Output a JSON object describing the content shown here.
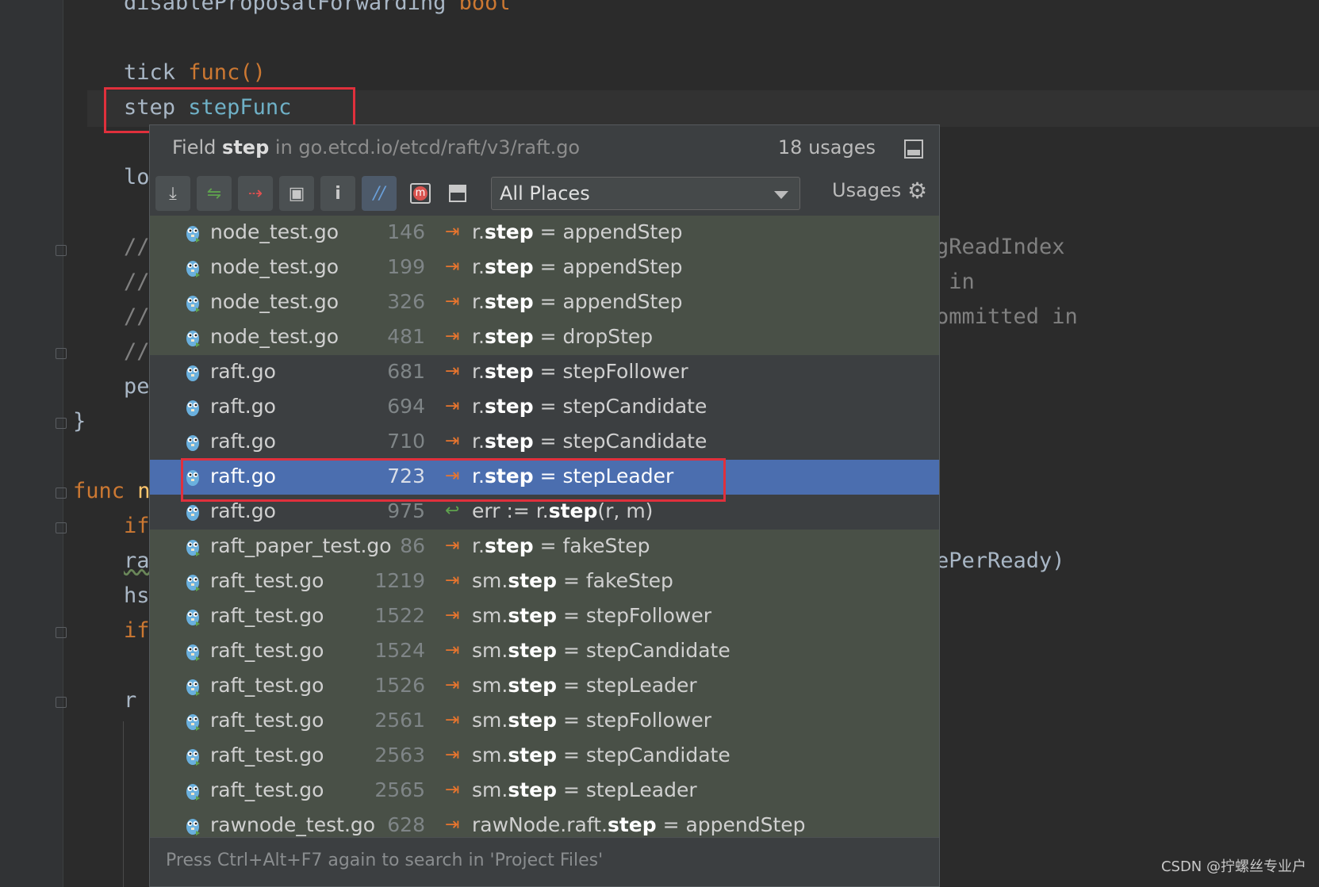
{
  "editor": {
    "lines": {
      "l1_field": "disableProposalForwarding",
      "l1_type": "bool",
      "l2_field": "tick",
      "l2_type": "func()",
      "l3_field": "step",
      "l3_type": "stepFunc",
      "l4": "lo",
      "c1": "//",
      "c2": "//",
      "c3": "//",
      "c4": "//",
      "pe": "pe",
      "brace": "}",
      "func_kw": "func",
      "func_rest": "n",
      "if1": "if",
      "ra": "ra",
      "hs": "hs",
      "if2": "if",
      "r": "r"
    },
    "right_fragments": {
      "f1": "gReadIndex",
      "f2": " in",
      "f3": "ommitted in",
      "f4": "ePerReady)"
    }
  },
  "popup": {
    "header": {
      "prefix": "Field",
      "name": "step",
      "location": "in go.etcd.io/etcd/raft/v3/raft.go",
      "usages_count": "18 usages",
      "pin_icon": "pin-icon"
    },
    "toolbar": {
      "buttons": [
        {
          "icon": "expand-all-icon",
          "glyph": "⤓"
        },
        {
          "icon": "read-access-icon",
          "glyph": "⇋"
        },
        {
          "icon": "write-access-icon",
          "glyph": "⇢"
        },
        {
          "icon": "group-by-directory-icon",
          "glyph": "▣"
        },
        {
          "icon": "info-icon",
          "glyph": "i"
        },
        {
          "icon": "merge-icon",
          "glyph": "//"
        },
        {
          "icon": "group-by-method-icon",
          "glyph": "m"
        },
        {
          "icon": "preview-icon",
          "glyph": "▬"
        }
      ],
      "scope": "All Places",
      "usages_label": "Usages",
      "gear_icon": "gear-icon"
    },
    "rows": [
      {
        "file": "node_test.go",
        "line": "146",
        "obj": "r.",
        "field": "step",
        "rest": " = appendStep",
        "kind": "write",
        "bg": "g"
      },
      {
        "file": "node_test.go",
        "line": "199",
        "obj": "r.",
        "field": "step",
        "rest": " = appendStep",
        "kind": "write",
        "bg": "g"
      },
      {
        "file": "node_test.go",
        "line": "326",
        "obj": "r.",
        "field": "step",
        "rest": " = appendStep",
        "kind": "write",
        "bg": "g"
      },
      {
        "file": "node_test.go",
        "line": "481",
        "obj": "r.",
        "field": "step",
        "rest": " = dropStep",
        "kind": "write",
        "bg": "g"
      },
      {
        "file": "raft.go",
        "line": "681",
        "obj": "r.",
        "field": "step",
        "rest": " = stepFollower",
        "kind": "write",
        "bg": "d"
      },
      {
        "file": "raft.go",
        "line": "694",
        "obj": "r.",
        "field": "step",
        "rest": " = stepCandidate",
        "kind": "write",
        "bg": "d"
      },
      {
        "file": "raft.go",
        "line": "710",
        "obj": "r.",
        "field": "step",
        "rest": " = stepCandidate",
        "kind": "write",
        "bg": "d"
      },
      {
        "file": "raft.go",
        "line": "723",
        "obj": "r.",
        "field": "step",
        "rest": " = stepLeader",
        "kind": "write",
        "bg": "sel"
      },
      {
        "file": "raft.go",
        "line": "975",
        "obj": "err := r.",
        "field": "step",
        "rest": "(r, m)",
        "kind": "read",
        "bg": "d"
      },
      {
        "file": "raft_paper_test.go",
        "line": "86",
        "obj": "r.",
        "field": "step",
        "rest": " = fakeStep",
        "kind": "write",
        "bg": "g"
      },
      {
        "file": "raft_test.go",
        "line": "1219",
        "obj": "sm.",
        "field": "step",
        "rest": " = fakeStep",
        "kind": "write",
        "bg": "g"
      },
      {
        "file": "raft_test.go",
        "line": "1522",
        "obj": "sm.",
        "field": "step",
        "rest": " = stepFollower",
        "kind": "write",
        "bg": "g"
      },
      {
        "file": "raft_test.go",
        "line": "1524",
        "obj": "sm.",
        "field": "step",
        "rest": " = stepCandidate",
        "kind": "write",
        "bg": "g"
      },
      {
        "file": "raft_test.go",
        "line": "1526",
        "obj": "sm.",
        "field": "step",
        "rest": " = stepLeader",
        "kind": "write",
        "bg": "g"
      },
      {
        "file": "raft_test.go",
        "line": "2561",
        "obj": "sm.",
        "field": "step",
        "rest": " = stepFollower",
        "kind": "write",
        "bg": "g"
      },
      {
        "file": "raft_test.go",
        "line": "2563",
        "obj": "sm.",
        "field": "step",
        "rest": " = stepCandidate",
        "kind": "write",
        "bg": "g"
      },
      {
        "file": "raft_test.go",
        "line": "2565",
        "obj": "sm.",
        "field": "step",
        "rest": " = stepLeader",
        "kind": "write",
        "bg": "g"
      },
      {
        "file": "rawnode_test.go",
        "line": "628",
        "obj": "rawNode.raft.",
        "field": "step",
        "rest": " = appendStep",
        "kind": "write",
        "bg": "g"
      }
    ],
    "footer": "Press Ctrl+Alt+F7 again to search in 'Project Files'"
  },
  "watermark": "CSDN @拧螺丝专业户",
  "colors": {
    "write_arrow": "#e8752e",
    "read_arrow": "#5fa24e",
    "selection": "#4b6eaf",
    "highlight_box": "#e0303c"
  }
}
